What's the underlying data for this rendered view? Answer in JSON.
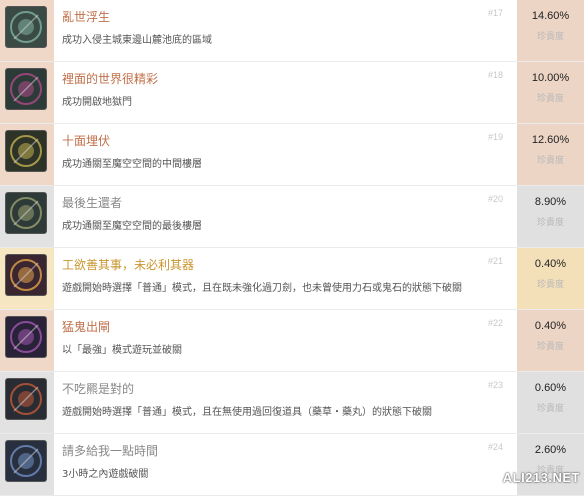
{
  "achievements": [
    {
      "title": "亂世浮生",
      "desc": "成功入侵主城東邊山麓池底的區域",
      "num": "#17",
      "pct": "14.60%",
      "rare": "珍貴度",
      "title_color": "#c0704a",
      "side_bg": "#f0d8c8",
      "pct_bg": "#ecd5c5",
      "icon_bg": "#3a4b45",
      "icon_fg": "#7fb0a0"
    },
    {
      "title": "裡面的世界很精彩",
      "desc": "成功開啟地獄門",
      "num": "#18",
      "pct": "10.00%",
      "rare": "珍貴度",
      "title_color": "#c0704a",
      "side_bg": "#f0d8c8",
      "pct_bg": "#ecd5c5",
      "icon_bg": "#2c3b38",
      "icon_fg": "#b04a8a"
    },
    {
      "title": "十面埋伏",
      "desc": "成功通關至魔空空間的中間樓層",
      "num": "#19",
      "pct": "12.60%",
      "rare": "珍貴度",
      "title_color": "#c0704a",
      "side_bg": "#f0d8c8",
      "pct_bg": "#ecd5c5",
      "icon_bg": "#2e3327",
      "icon_fg": "#c2b050"
    },
    {
      "title": "最後生還者",
      "desc": "成功通關至魔空空間的最後樓層",
      "num": "#20",
      "pct": "8.90%",
      "rare": "珍貴度",
      "title_color": "#888888",
      "side_bg": "#e2e2e2",
      "pct_bg": "#e0e0e0",
      "icon_bg": "#2e3a38",
      "icon_fg": "#9aa070"
    },
    {
      "title": "工欲善其事，未必利其器",
      "desc": "遊戲開始時選擇「普通」模式，且在既未強化過刀劍，也未曾使用力石或鬼石的狀態下破關",
      "num": "#21",
      "pct": "0.40%",
      "rare": "珍貴度",
      "title_color": "#c9962e",
      "side_bg": "#f7e6c2",
      "pct_bg": "#f3dfb8",
      "icon_bg": "#3a2630",
      "icon_fg": "#e2a24a"
    },
    {
      "title": "猛鬼出閘",
      "desc": "以「最強」模式遊玩並破關",
      "num": "#22",
      "pct": "0.40%",
      "rare": "珍貴度",
      "title_color": "#c0704a",
      "side_bg": "#f0d8c8",
      "pct_bg": "#ecd5c5",
      "icon_bg": "#2a2238",
      "icon_fg": "#a058b0"
    },
    {
      "title": "不吃羆是對的",
      "desc": "遊戲開始時選擇「普通」模式，且在無使用過回復道具（藥草・藥丸）的狀態下破關",
      "num": "#23",
      "pct": "0.60%",
      "rare": "珍貴度",
      "title_color": "#888888",
      "side_bg": "#e2e2e2",
      "pct_bg": "#e0e0e0",
      "icon_bg": "#2a2c33",
      "icon_fg": "#c05a3a"
    },
    {
      "title": "請多給我一點時間",
      "desc": "3小時之內遊戲破關",
      "num": "#24",
      "pct": "2.60%",
      "rare": "珍貴度",
      "title_color": "#888888",
      "side_bg": "#e2e2e2",
      "pct_bg": "#e0e0e0",
      "icon_bg": "#283040",
      "icon_fg": "#6f8fc0"
    }
  ],
  "watermark": "ALI213.NET"
}
